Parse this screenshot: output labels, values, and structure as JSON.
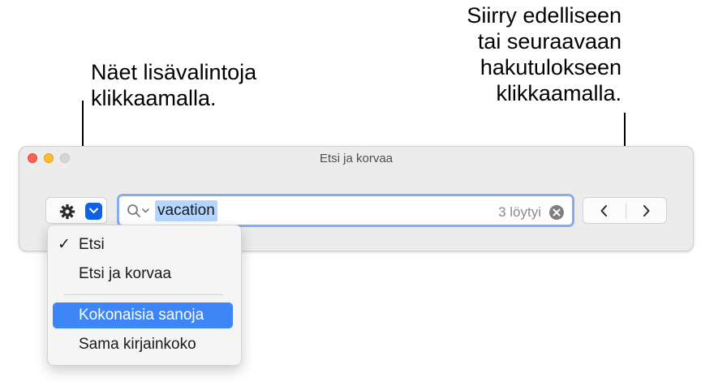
{
  "callouts": {
    "left": "Näet lisävalintoja\nklikkaamalla.",
    "right": "Siirry edelliseen\ntai seuraavaan\nhakutulokseen\nklikkaamalla."
  },
  "window": {
    "title": "Etsi ja korvaa"
  },
  "toolbar": {
    "options_icon": "gear-icon",
    "dropdown_icon": "chevron-down-icon",
    "search_value": "vacation",
    "result_count": "3 löytyi",
    "prev_icon": "chevron-left-icon",
    "next_icon": "chevron-right-icon"
  },
  "menu": {
    "items": [
      {
        "label": "Etsi",
        "checked": true,
        "check_mark": "✓"
      },
      {
        "label": "Etsi ja korvaa",
        "checked": false
      },
      {
        "label": "Kokonaisia sanoja",
        "highlighted": true
      },
      {
        "label": "Sama kirjainkoko"
      }
    ]
  },
  "colors": {
    "accent": "#1062e5",
    "highlight": "#3c86f7",
    "focus_ring": "#84adf0",
    "selection": "#b3d5ff"
  }
}
